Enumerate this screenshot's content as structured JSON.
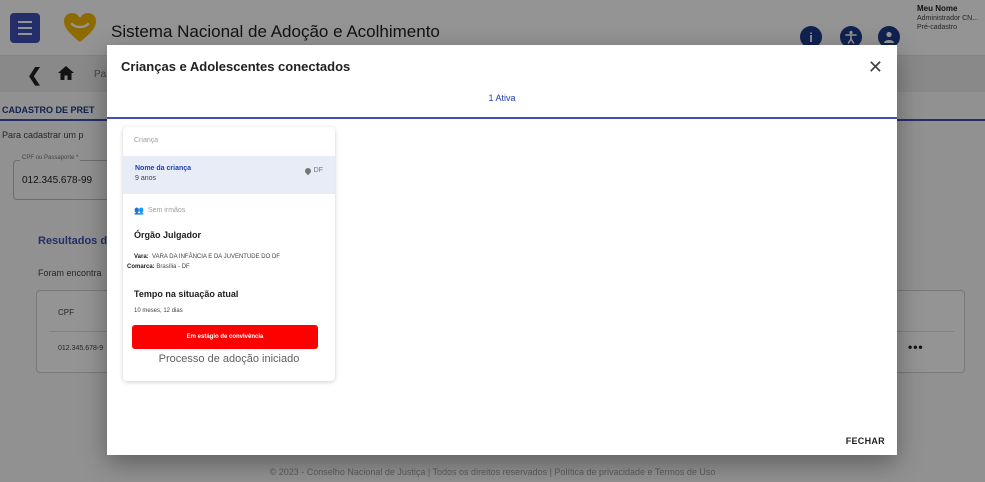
{
  "header": {
    "title": "Sistema Nacional de Adoção e Acolhimento",
    "user_name": "Meu Nome",
    "user_role": "Administrador CN...",
    "user_status": "Pré-cadastro"
  },
  "breadcrumb": {
    "text": "Pa"
  },
  "background": {
    "tab_label": "CADASTRO DE PRET",
    "paragraph": "Para cadastrar um p",
    "field_label": "CPF ou Passaporte *",
    "field_value": "012.345.678-99",
    "results_title": "Resultados d",
    "found_text": "Foram encontra",
    "table_header_cpf": "CPF",
    "table_cell_cpf": "012.345.678-9",
    "row_menu": "•••"
  },
  "footer": {
    "text": "© 2023 - Conselho Nacional de Justiça | Todos os direitos reservados | Política de privacidade e Termos de Uso"
  },
  "dialog": {
    "title": "Crianças e Adolescentes conectados",
    "tab_label": "1 Ativa",
    "close_label": "FECHAR",
    "card": {
      "header": "Criança",
      "child_name": "Nome da criança",
      "child_age": "9 anos",
      "location": "DF",
      "siblings": "Sem irmãos",
      "org_title": "Órgão Julgador",
      "vara_label": "Vara:",
      "vara_value": "VARA DA INFÂNCIA E DA JUVENTUDE DO DF",
      "comarca_label": "Comarca:",
      "comarca_value": "Brasília - DF",
      "time_title": "Tempo na situação atual",
      "time_value": "10 meses, 12 dias",
      "status_button": "Em estágio de convivência",
      "process_text": "Processo de adoção iniciado"
    }
  },
  "colors": {
    "primary": "#3f51b5",
    "status_red": "#ff0000",
    "logo_yellow": "#f5b800"
  }
}
